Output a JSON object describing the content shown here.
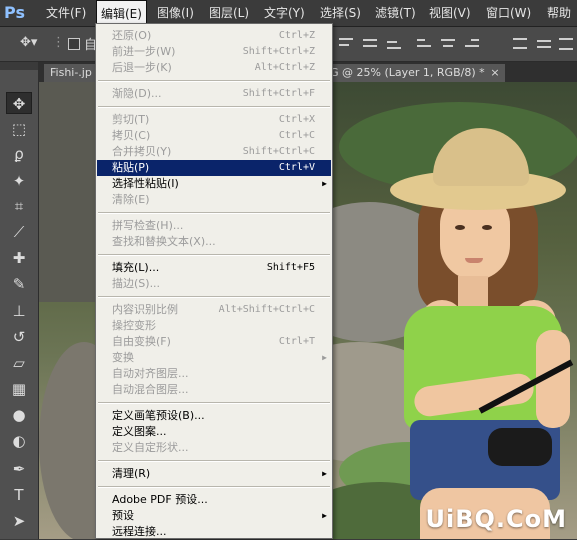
{
  "app": {
    "logo": "Ps"
  },
  "menubar": [
    {
      "label": "文件(F)"
    },
    {
      "label": "编辑(E)"
    },
    {
      "label": "图像(I)"
    },
    {
      "label": "图层(L)"
    },
    {
      "label": "文字(Y)"
    },
    {
      "label": "选择(S)"
    },
    {
      "label": "滤镜(T)"
    },
    {
      "label": "视图(V)"
    },
    {
      "label": "窗口(W)"
    },
    {
      "label": "帮助"
    }
  ],
  "options": {
    "auto_select_label": "自"
  },
  "tabs": [
    {
      "label": "Fishi-.jp"
    },
    {
      "label": "G @ 25% (Layer 1, RGB/8) *"
    }
  ],
  "tab_close": "×",
  "edit_menu": [
    {
      "label": "还原(O)",
      "shortcut": "Ctrl+Z",
      "disabled": true
    },
    {
      "label": "前进一步(W)",
      "shortcut": "Shift+Ctrl+Z",
      "disabled": true
    },
    {
      "label": "后退一步(K)",
      "shortcut": "Alt+Ctrl+Z",
      "disabled": true
    },
    {
      "label": "渐隐(D)...",
      "shortcut": "Shift+Ctrl+F",
      "disabled": true
    },
    {
      "label": "剪切(T)",
      "shortcut": "Ctrl+X",
      "disabled": true
    },
    {
      "label": "拷贝(C)",
      "shortcut": "Ctrl+C",
      "disabled": true
    },
    {
      "label": "合并拷贝(Y)",
      "shortcut": "Shift+Ctrl+C",
      "disabled": true
    },
    {
      "label": "粘贴(P)",
      "shortcut": "Ctrl+V",
      "disabled": false,
      "highlighted": true
    },
    {
      "label": "选择性粘贴(I)",
      "shortcut": "",
      "disabled": false,
      "submenu": true
    },
    {
      "label": "清除(E)",
      "shortcut": "",
      "disabled": true
    },
    {
      "label": "拼写检查(H)...",
      "shortcut": "",
      "disabled": true
    },
    {
      "label": "查找和替换文本(X)...",
      "shortcut": "",
      "disabled": true
    },
    {
      "label": "填充(L)...",
      "shortcut": "Shift+F5",
      "disabled": false
    },
    {
      "label": "描边(S)...",
      "shortcut": "",
      "disabled": true
    },
    {
      "label": "内容识别比例",
      "shortcut": "Alt+Shift+Ctrl+C",
      "disabled": true
    },
    {
      "label": "操控变形",
      "shortcut": "",
      "disabled": true
    },
    {
      "label": "自由变换(F)",
      "shortcut": "Ctrl+T",
      "disabled": true
    },
    {
      "label": "变换",
      "shortcut": "",
      "disabled": true,
      "submenu": true
    },
    {
      "label": "自动对齐图层...",
      "shortcut": "",
      "disabled": true
    },
    {
      "label": "自动混合图层...",
      "shortcut": "",
      "disabled": true
    },
    {
      "label": "定义画笔预设(B)...",
      "shortcut": "",
      "disabled": false
    },
    {
      "label": "定义图案...",
      "shortcut": "",
      "disabled": false
    },
    {
      "label": "定义自定形状...",
      "shortcut": "",
      "disabled": true
    },
    {
      "label": "清理(R)",
      "shortcut": "",
      "disabled": false,
      "submenu": true
    },
    {
      "label": "Adobe PDF 预设...",
      "shortcut": "",
      "disabled": false
    },
    {
      "label": "预设",
      "shortcut": "",
      "disabled": false,
      "submenu": true
    },
    {
      "label": "远程连接...",
      "shortcut": "",
      "disabled": false
    }
  ],
  "tools": [
    {
      "icon": "move-icon",
      "glyph": "✥"
    },
    {
      "icon": "marquee-icon",
      "glyph": "⬚"
    },
    {
      "icon": "lasso-icon",
      "glyph": "ϼ"
    },
    {
      "icon": "magic-wand-icon",
      "glyph": "✦"
    },
    {
      "icon": "crop-icon",
      "glyph": "⌗"
    },
    {
      "icon": "eyedropper-icon",
      "glyph": "⟋"
    },
    {
      "icon": "healing-brush-icon",
      "glyph": "✚"
    },
    {
      "icon": "brush-icon",
      "glyph": "✎"
    },
    {
      "icon": "clone-stamp-icon",
      "glyph": "⊥"
    },
    {
      "icon": "history-brush-icon",
      "glyph": "↺"
    },
    {
      "icon": "eraser-icon",
      "glyph": "▱"
    },
    {
      "icon": "gradient-icon",
      "glyph": "▦"
    },
    {
      "icon": "blur-icon",
      "glyph": "●"
    },
    {
      "icon": "dodge-icon",
      "glyph": "◐"
    },
    {
      "icon": "pen-icon",
      "glyph": "✒"
    },
    {
      "icon": "type-icon",
      "glyph": "T"
    },
    {
      "icon": "path-selection-icon",
      "glyph": "➤"
    }
  ],
  "watermark": "UiBQ.CoM",
  "colors": {
    "highlight": "#0a246a",
    "menu_bg": "#f0efe9",
    "ui_dark": "#3b3b3b"
  }
}
